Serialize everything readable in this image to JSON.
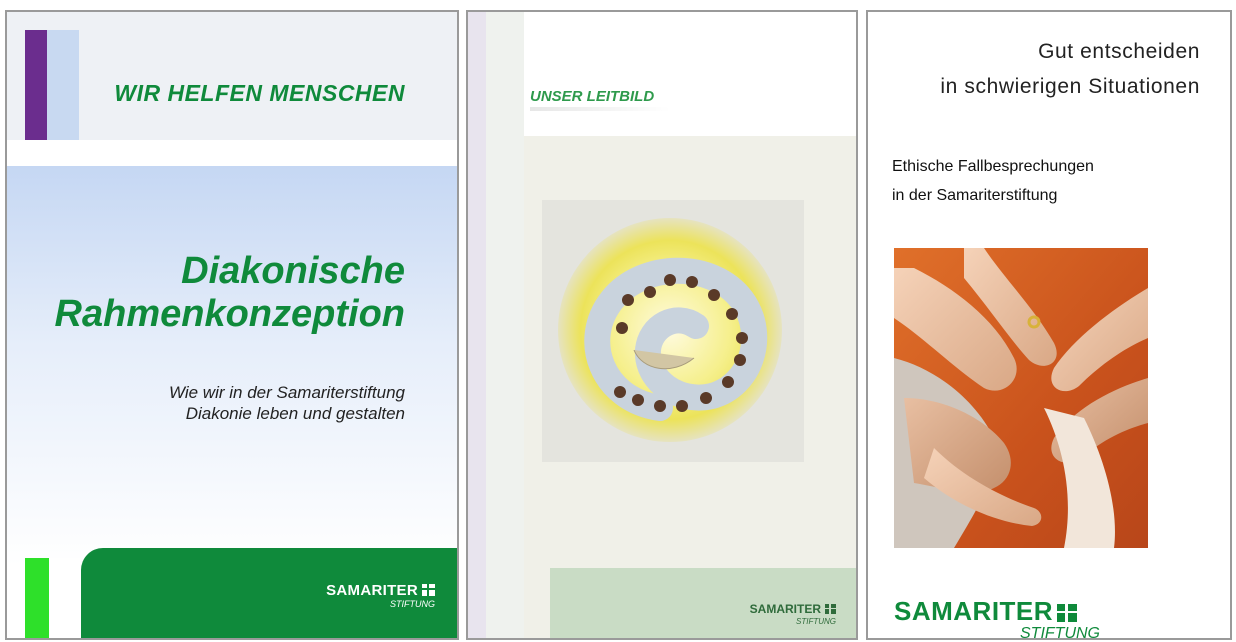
{
  "panel1": {
    "tagline": "WIR HELFEN MENSCHEN",
    "title_line1": "Diakonische",
    "title_line2": "Rahmenkonzeption",
    "subtitle_line1": "Wie wir in der Samariterstiftung",
    "subtitle_line2": "Diakonie leben und gestalten",
    "logo_main": "SAMARITER",
    "logo_sub": "STIFTUNG"
  },
  "panel2": {
    "title": "UNSER LEITBILD",
    "logo_main": "SAMARITER",
    "logo_sub": "STIFTUNG"
  },
  "panel3": {
    "title_line1": "Gut entscheiden",
    "title_line2": "in schwierigen Situationen",
    "subtitle_line1": "Ethische Fallbesprechungen",
    "subtitle_line2": "in der Samariterstiftung",
    "logo_main": "SAMARITER",
    "logo_sub": "STIFTUNG"
  },
  "colors": {
    "brand_green": "#0f8a3b",
    "purple": "#6b2d8e",
    "light_blue": "#c8d9f1",
    "bright_green": "#2ee02a"
  }
}
